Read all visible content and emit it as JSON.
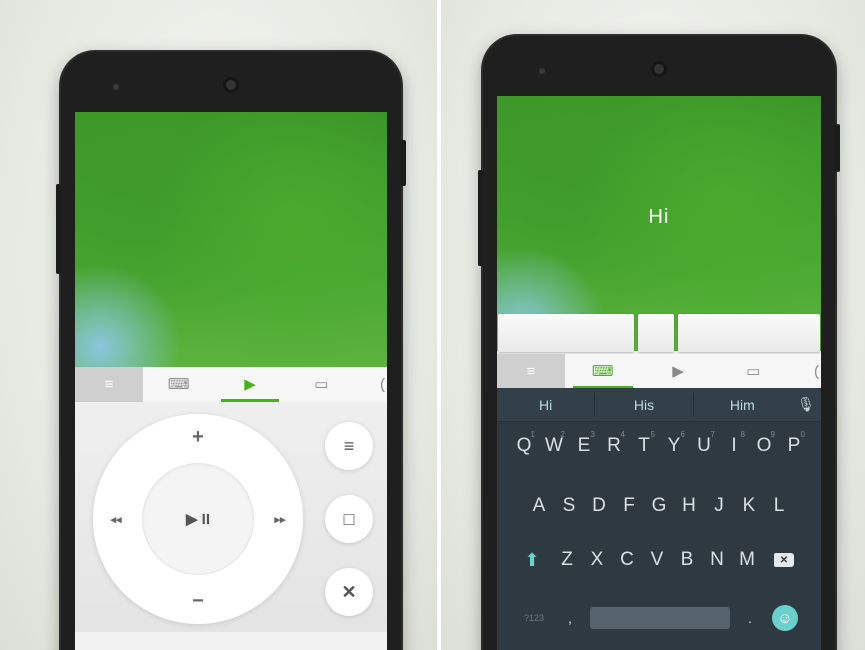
{
  "left_panel": {
    "tabs": [
      {
        "name": "menu",
        "glyph": "≡"
      },
      {
        "name": "keyboard",
        "glyph": "⌨"
      },
      {
        "name": "play",
        "glyph": "▶"
      },
      {
        "name": "window",
        "glyph": "▭"
      },
      {
        "name": "more",
        "glyph": "("
      }
    ],
    "remote": {
      "volume_up": "+",
      "volume_down": "−",
      "rewind": "◂◂",
      "fast_forward": "▸▸",
      "play_pause": "▶ II",
      "list_btn": "≡",
      "stop_btn": "□",
      "close_btn": "✕"
    }
  },
  "right_panel": {
    "typed_text": "Hi",
    "tabs": [
      {
        "name": "menu",
        "glyph": "≡"
      },
      {
        "name": "keyboard",
        "glyph": "⌨"
      },
      {
        "name": "play",
        "glyph": "▶"
      },
      {
        "name": "window",
        "glyph": "▭"
      },
      {
        "name": "more",
        "glyph": "("
      }
    ],
    "suggestions": [
      "Hi",
      "His",
      "Him"
    ],
    "mic_glyph": "🎙",
    "keyboard": {
      "row1": [
        {
          "k": "Q",
          "n": "1"
        },
        {
          "k": "W",
          "n": "2"
        },
        {
          "k": "E",
          "n": "3"
        },
        {
          "k": "R",
          "n": "4"
        },
        {
          "k": "T",
          "n": "5"
        },
        {
          "k": "Y",
          "n": "6"
        },
        {
          "k": "U",
          "n": "7"
        },
        {
          "k": "I",
          "n": "8"
        },
        {
          "k": "O",
          "n": "9"
        },
        {
          "k": "P",
          "n": "0"
        }
      ],
      "row2": [
        "A",
        "S",
        "D",
        "F",
        "G",
        "H",
        "J",
        "K",
        "L"
      ],
      "row3": [
        "Z",
        "X",
        "C",
        "V",
        "B",
        "N",
        "M"
      ],
      "symbols_label": "?123",
      "comma": ",",
      "period": ".",
      "shift_glyph": "⬆",
      "backspace_glyph": "✕",
      "emoji_glyph": "☺"
    }
  },
  "colors": {
    "accent_green": "#49b11f",
    "keyboard_bg": "#2f3941",
    "teal": "#6ad0cb"
  }
}
